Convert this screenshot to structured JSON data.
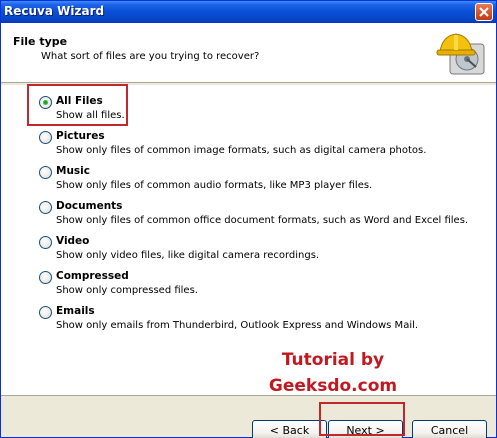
{
  "window": {
    "title": "Recuva Wizard"
  },
  "header": {
    "title": "File type",
    "subtitle": "What sort of files are you trying to recover?",
    "icon": "recuva-hardhat-drive-icon"
  },
  "options": [
    {
      "label": "All Files",
      "description": "Show all files.",
      "checked": true
    },
    {
      "label": "Pictures",
      "description": "Show only files of common image formats, such as digital camera photos.",
      "checked": false
    },
    {
      "label": "Music",
      "description": "Show only files of common audio formats, like MP3 player files.",
      "checked": false
    },
    {
      "label": "Documents",
      "description": "Show only files of common office document formats, such as Word and Excel files.",
      "checked": false
    },
    {
      "label": "Video",
      "description": "Show only video files, like digital camera recordings.",
      "checked": false
    },
    {
      "label": "Compressed",
      "description": "Show only compressed files.",
      "checked": false
    },
    {
      "label": "Emails",
      "description": "Show only emails from Thunderbird, Outlook Express and Windows Mail.",
      "checked": false
    }
  ],
  "overlay": {
    "line1": "Tutorial by",
    "line2": "Geeksdo.com",
    "color": "#c01a20"
  },
  "buttons": {
    "back": "< Back",
    "next": "Next >",
    "cancel": "Cancel"
  },
  "colors": {
    "highlight": "#c0282e",
    "titlebar": "#0a50d8",
    "radio_selected": "#21a121"
  }
}
